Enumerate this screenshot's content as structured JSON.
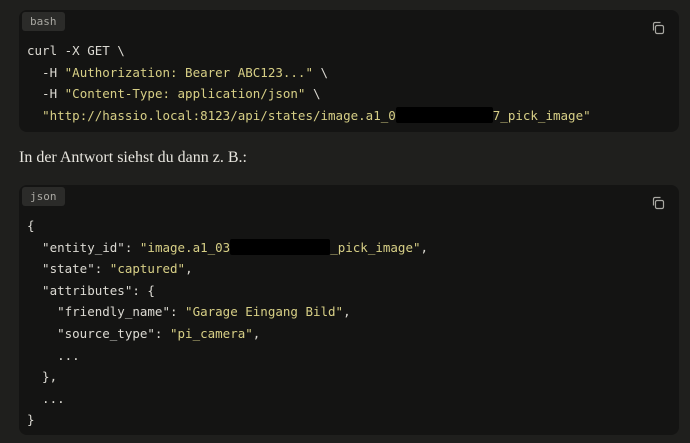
{
  "bash_block": {
    "lang": "bash",
    "copy_icon": "copy-icon",
    "line1": "curl -X GET \\",
    "line2_flag": "  -H ",
    "line2_str": "\"Authorization: Bearer ABC123...\"",
    "line2_tail": " \\",
    "line3_flag": "  -H ",
    "line3_str": "\"Content-Type: application/json\"",
    "line3_tail": " \\",
    "line4_indent": "  ",
    "line4_str_a": "\"http://hassio.local:8123/api/states/image.a1_0",
    "line4_str_b": "7_pick_image\""
  },
  "prose": {
    "text": "In der Antwort siehst du dann z. B.:"
  },
  "json_block": {
    "lang": "json",
    "copy_icon": "copy-icon",
    "l1": "{",
    "l2_key": "  \"entity_id\": ",
    "l2_str_a": "\"image.a1_03",
    "l2_str_b": "_pick_image\"",
    "l2_tail": ",",
    "l3_key": "  \"state\": ",
    "l3_str": "\"captured\"",
    "l3_tail": ",",
    "l4": "  \"attributes\": {",
    "l5_key": "    \"friendly_name\": ",
    "l5_str": "\"Garage Eingang Bild\"",
    "l5_tail": ",",
    "l6_key": "    \"source_type\": ",
    "l6_str": "\"pi_camera\"",
    "l6_tail": ",",
    "l7": "    ...",
    "l8": "  },",
    "l9": "  ...",
    "l10": "}"
  },
  "colors": {
    "page_bg": "#1f1f1d",
    "code_bg": "#141413",
    "string": "#d7cf86",
    "text": "#dcdad3"
  }
}
